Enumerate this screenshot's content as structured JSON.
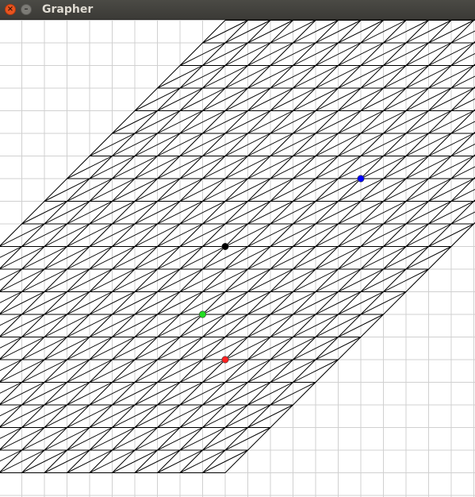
{
  "window": {
    "title": "Grapher",
    "close_icon": "close-icon",
    "minimize_icon": "minimize-icon",
    "close_glyph": "×",
    "minimize_glyph": "–"
  },
  "grapher": {
    "grid_color": "#d0d0d0",
    "line_color": "#000000",
    "background": "#ffffff",
    "grid_step_units": 1,
    "lattice": {
      "basis_u": [
        1,
        0
      ],
      "basis_v": [
        1,
        1
      ],
      "u_range": [
        -10,
        10
      ],
      "v_range": [
        -10,
        10
      ],
      "diagonal_direction": [
        1,
        1
      ]
    },
    "points": [
      {
        "name": "origin",
        "color": "#000000",
        "x": 0,
        "y": 0
      },
      {
        "name": "blue",
        "color": "#0000ff",
        "x": 6,
        "y": 3
      },
      {
        "name": "green",
        "color": "#22dd22",
        "x": -1,
        "y": -3
      },
      {
        "name": "red",
        "color": "#ff2222",
        "x": 0,
        "y": -5
      }
    ]
  }
}
